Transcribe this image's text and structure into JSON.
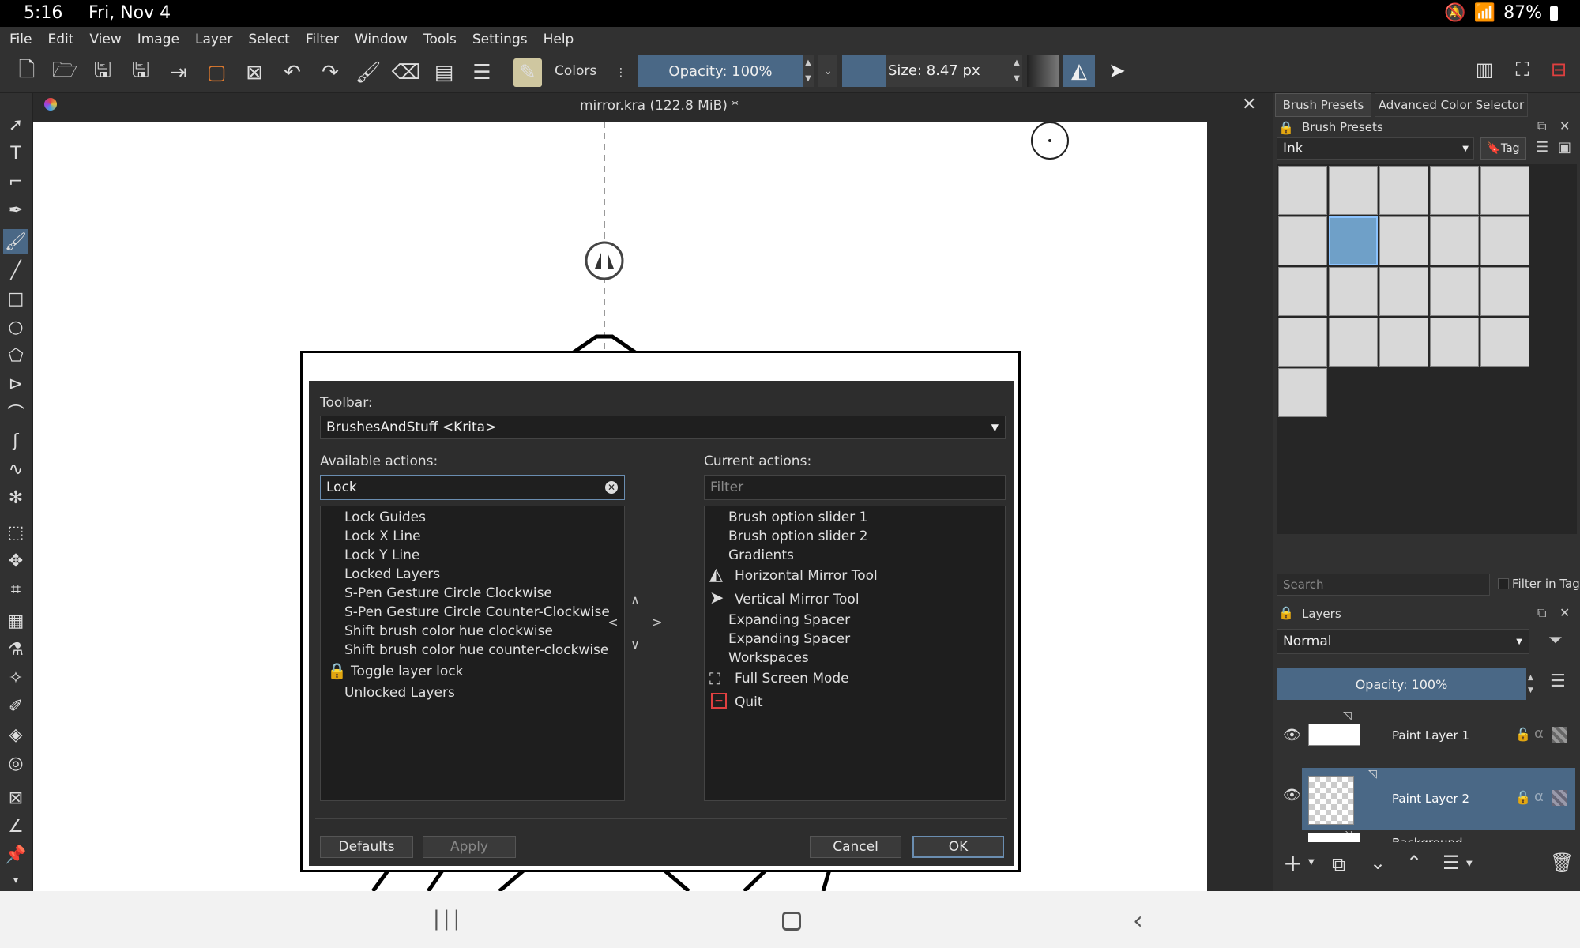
{
  "status": {
    "time": "5:16",
    "date": "Fri, Nov 4",
    "battery": "87%"
  },
  "menu": [
    "File",
    "Edit",
    "View",
    "Image",
    "Layer",
    "Select",
    "Filter",
    "Window",
    "Tools",
    "Settings",
    "Help"
  ],
  "toolbar": {
    "colors_label": "Colors",
    "opacity_label": "Opacity: 100%",
    "size_label": "Size: 8.47 px"
  },
  "document": {
    "title": "mirror.kra (122.8 MiB)  *"
  },
  "dialog": {
    "toolbar_label": "Toolbar:",
    "toolbar_value": "BrushesAndStuff <Krita>",
    "available_label": "Available actions:",
    "available_filter": "Lock",
    "current_label": "Current actions:",
    "current_filter_placeholder": "Filter",
    "available_items": [
      "Lock Guides",
      "Lock X Line",
      "Lock Y Line",
      "Locked Layers",
      "S-Pen Gesture Circle Clockwise",
      "S-Pen Gesture Circle Counter-Clockwise",
      "Shift brush color hue clockwise",
      "Shift brush color hue counter-clockwise",
      "Toggle layer lock",
      "Unlocked Layers"
    ],
    "current_items": [
      "Brush option slider 1",
      "Brush option slider 2",
      "Gradients",
      "Horizontal Mirror Tool",
      "Vertical Mirror Tool",
      "Expanding Spacer",
      "Expanding Spacer",
      "Workspaces",
      "Full Screen Mode",
      "Quit"
    ],
    "defaults": "Defaults",
    "apply": "Apply",
    "cancel": "Cancel",
    "ok": "OK"
  },
  "brush_presets": {
    "tab1": "Brush Presets",
    "tab2": "Advanced Color Selector",
    "title": "Brush Presets",
    "tag_value": "Ink",
    "tag_button": "Tag",
    "search_placeholder": "Search",
    "filter_in_tag": "Filter in Tag"
  },
  "layers": {
    "title": "Layers",
    "blend_mode": "Normal",
    "opacity": "Opacity:  100%",
    "items": [
      "Paint Layer 1",
      "Paint Layer 2",
      "Background"
    ]
  },
  "colors": {
    "accent": "#4a6886",
    "panel": "#313131",
    "dark": "#1e1e1e",
    "quit": "#e04040"
  }
}
